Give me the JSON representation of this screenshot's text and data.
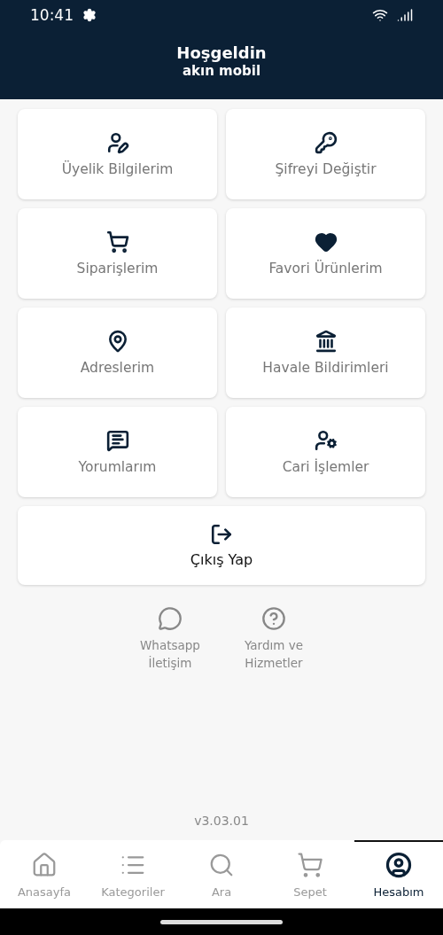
{
  "status_bar": {
    "time": "10:41"
  },
  "header": {
    "title": "Hoşgeldin",
    "subtitle": "akın mobil"
  },
  "menu": [
    {
      "label": "Üyelik Bilgilerim"
    },
    {
      "label": "Şifreyi Değiştir"
    },
    {
      "label": "Siparişlerim"
    },
    {
      "label": "Favori Ürünlerim"
    },
    {
      "label": "Adreslerim"
    },
    {
      "label": "Havale Bildirimleri"
    },
    {
      "label": "Yorumlarım"
    },
    {
      "label": "Cari İşlemler"
    }
  ],
  "logout": {
    "label": "Çıkış Yap"
  },
  "links": [
    {
      "label": "Whatsapp\nİletişim"
    },
    {
      "label": "Yardım ve\nHizmetler"
    }
  ],
  "version": "v3.03.01",
  "bottom_nav": [
    {
      "label": "Anasayfa",
      "selected": false
    },
    {
      "label": "Kategoriler",
      "selected": false
    },
    {
      "label": "Ara",
      "selected": false
    },
    {
      "label": "Sepet",
      "selected": false
    },
    {
      "label": "Hesabım",
      "selected": true
    }
  ]
}
